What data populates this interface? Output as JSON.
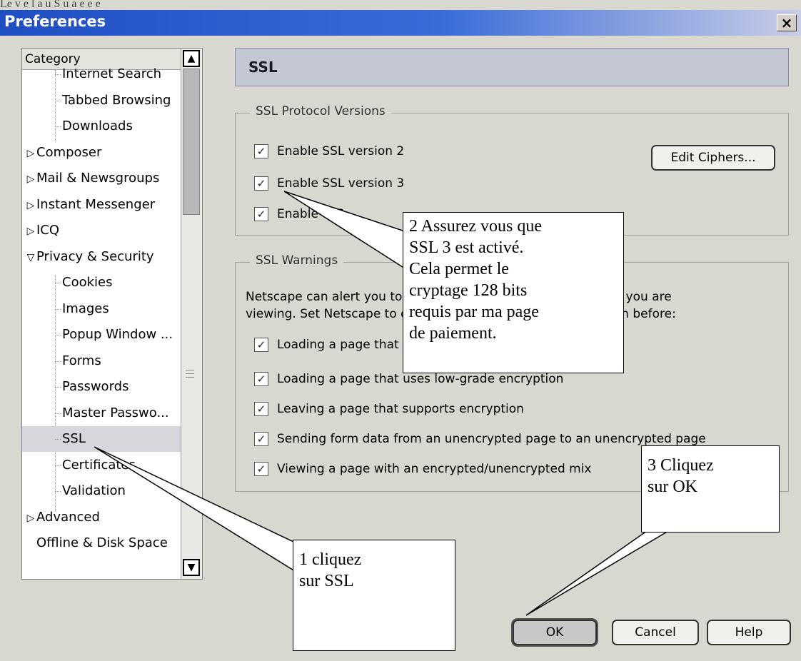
{
  "top_strip_text": "Le v e l                  a  u                 S  u        a      e          e                               e",
  "window": {
    "title": "Preferences",
    "close_glyph": "×"
  },
  "tree": {
    "header": "Category",
    "items": [
      {
        "label": "Internet Search",
        "level": "sub"
      },
      {
        "label": "Tabbed Browsing",
        "level": "sub"
      },
      {
        "label": "Downloads",
        "level": "sub"
      },
      {
        "label": "Composer",
        "level": "top",
        "icon": "collapsed-triangle-icon"
      },
      {
        "label": "Mail & Newsgroups",
        "level": "top",
        "icon": "collapsed-triangle-icon"
      },
      {
        "label": "Instant Messenger",
        "level": "top",
        "icon": "collapsed-triangle-icon"
      },
      {
        "label": "ICQ",
        "level": "top",
        "icon": "collapsed-triangle-icon"
      },
      {
        "label": "Privacy & Security",
        "level": "top",
        "icon": "expanded-triangle-icon"
      },
      {
        "label": "Cookies",
        "level": "sub"
      },
      {
        "label": "Images",
        "level": "sub"
      },
      {
        "label": "Popup Window ...",
        "level": "sub"
      },
      {
        "label": "Forms",
        "level": "sub"
      },
      {
        "label": "Passwords",
        "level": "sub"
      },
      {
        "label": "Master Passwo...",
        "level": "sub"
      },
      {
        "label": "SSL",
        "level": "sub",
        "selected": true
      },
      {
        "label": "Certificates",
        "level": "sub"
      },
      {
        "label": "Validation",
        "level": "sub"
      },
      {
        "label": "Advanced",
        "level": "top",
        "icon": "collapsed-triangle-icon"
      },
      {
        "label": "Offline & Disk Space",
        "level": "top"
      }
    ],
    "glyphs": {
      "collapsed": "▷",
      "expanded": "▽",
      "up": "▲",
      "down": "▼"
    }
  },
  "panel": {
    "title": "SSL",
    "protocol_group": {
      "legend": "SSL Protocol Versions",
      "options": [
        {
          "label": "Enable SSL version 2",
          "checked": true
        },
        {
          "label": "Enable SSL version 3",
          "checked": true
        },
        {
          "label": "Enable TLS",
          "checked": true
        }
      ],
      "edit_ciphers_label": "Edit Ciphers..."
    },
    "warnings_group": {
      "legend": "SSL Warnings",
      "description_line1": "Netscape can alert you to the security status of the web page you are",
      "description_line2": "viewing. Set Netscape to display a warning and ask permission before:",
      "options": [
        {
          "label": "Loading a page that supports encryption",
          "checked": true
        },
        {
          "label": "Loading a page that uses low-grade encryption",
          "checked": true
        },
        {
          "label": "Leaving a page that supports encryption",
          "checked": true
        },
        {
          "label": "Sending form data from an unencrypted page to an unencrypted page",
          "checked": true
        },
        {
          "label": "Viewing a page with an encrypted/unencrypted mix",
          "checked": true
        }
      ]
    },
    "check_glyph": "✓"
  },
  "buttons": {
    "ok": "OK",
    "cancel": "Cancel",
    "help": "Help"
  },
  "callouts": {
    "step1": [
      "1 cliquez",
      "sur SSL"
    ],
    "step2": [
      "2 Assurez vous que",
      "SSL 3 est activé.",
      "Cela permet le",
      "cryptage 128 bits",
      "requis par ma page",
      "de paiement."
    ],
    "step3": [
      "3 Cliquez",
      "sur OK"
    ]
  }
}
